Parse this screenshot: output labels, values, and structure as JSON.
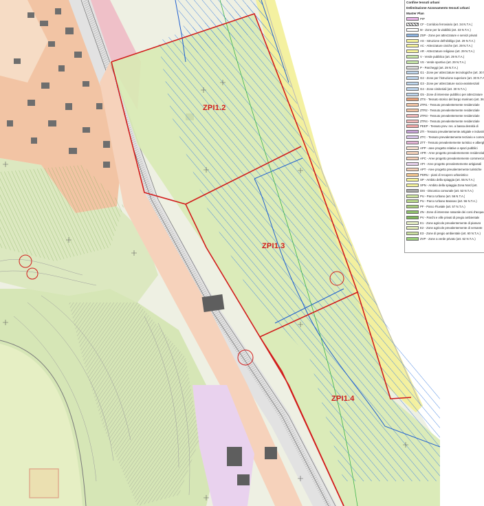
{
  "legend": {
    "top_lines": [
      "Confine tessuti urbani",
      "Delimitazione Azzonamento tessuti urbani"
    ],
    "header": "Master Plan",
    "items": [
      {
        "label": "PIP",
        "color": "#e9b6e8",
        "pattern": "solid"
      },
      {
        "label": "CF - Corridoio ferroviario (art. 34 N.T.A.)",
        "color": "#bfbfbf",
        "pattern": "hatch"
      },
      {
        "label": "M - Zone per la viabilità (art. 33 N.T.A.)",
        "color": "#ffffff",
        "pattern": "solid"
      },
      {
        "label": "ZSP - Zone per attrezzature e servizi privati",
        "color": "#8db4e2",
        "pattern": "solid"
      },
      {
        "label": "AS - Istruzione dell'obbligo (art. 29 N.T.A.)",
        "color": "#f6f39a",
        "pattern": "solid"
      },
      {
        "label": "AC - Attrezzature civiche (art. 29 N.T.A.)",
        "color": "#f6f39a",
        "pattern": "solid"
      },
      {
        "label": "AR - Attrezzature religiose (art. 29 N.T.A.)",
        "color": "#f6f39a",
        "pattern": "solid"
      },
      {
        "label": "V - Verde pubblico (art. 29 N.T.A.)",
        "color": "#c6e6a8",
        "pattern": "solid"
      },
      {
        "label": "VS - Verde sportivo (art. 29 N.T.A.)",
        "color": "#c6e6a8",
        "pattern": "solid"
      },
      {
        "label": "P - Parcheggi (art. 29 N.T.A.)",
        "color": "#d9d9d9",
        "pattern": "solid"
      },
      {
        "label": "G1 - Zone per attrezzature tecnologiche (art. 30 N.T.A.)",
        "color": "#bfd7ee",
        "pattern": "solid"
      },
      {
        "label": "G2 - Zone per l'istruzione superiore (art. 30 N.T.A.)",
        "color": "#bfd7ee",
        "pattern": "solid"
      },
      {
        "label": "G3 - Zone per attrezzature socio-assistenziali",
        "color": "#bfd7ee",
        "pattern": "solid"
      },
      {
        "label": "G4 - Zone cimiteriali (art. 30 N.T.A.)",
        "color": "#bfd7ee",
        "pattern": "solid"
      },
      {
        "label": "G5 - Zone di interesse pubblico per attrezzature",
        "color": "#bfd7ee",
        "pattern": "solid"
      },
      {
        "label": "ZTS - Tessuto storico del borgo marinaro (art. 36 N.T.A.)",
        "color": "#e8a27a",
        "pattern": "solid"
      },
      {
        "label": "ZTR1 - Tessuto prevalentemente residenziale",
        "color": "#f2c4a4",
        "pattern": "solid"
      },
      {
        "label": "ZTR2 - Tessuto prevalentemente residenziale",
        "color": "#f2c4a4",
        "pattern": "solid"
      },
      {
        "label": "ZTR3 - Tessuto prevalentemente residenziale",
        "color": "#f0b8b8",
        "pattern": "solid"
      },
      {
        "label": "ZTR4 - Tessuto prevalentemente residenziale",
        "color": "#f0b8b8",
        "pattern": "solid"
      },
      {
        "label": "PEEP - Tessuto prev. res. a bassa densità di",
        "color": "#f1a6a6",
        "pattern": "solid"
      },
      {
        "label": "ZTI - Tessuto prevalentemente artigiale e industriale",
        "color": "#c9a3d9",
        "pattern": "solid"
      },
      {
        "label": "ZTC - Tessuto prevalentemente terziario e commerciale",
        "color": "#d9c6ea",
        "pattern": "solid"
      },
      {
        "label": "ZTT - Tessuto prevalentemente turistico e alberghiero",
        "color": "#e5b3d6",
        "pattern": "solid"
      },
      {
        "label": "APP - aree progetto relative a spazi pubblici",
        "color": "#f6e1d1",
        "pattern": "solid"
      },
      {
        "label": "APR - Aree progetto prevalentemente residenziali",
        "color": "#f6d2bb",
        "pattern": "solid"
      },
      {
        "label": "APC - Aree progetto prevalentemente commerciali",
        "color": "#f6d2bb",
        "pattern": "solid"
      },
      {
        "label": "API - Aree progetto prevalentemente artigianali",
        "color": "#e9d2ee",
        "pattern": "solid"
      },
      {
        "label": "APT - Aree progetto prevalentemente turistiche",
        "color": "#f6d2bb",
        "pattern": "solid"
      },
      {
        "label": "PDRU - piani di recupero urbanistico",
        "color": "#f5c58e",
        "pattern": "solid"
      },
      {
        "label": "SP - Ambito della spiaggia (art. 55 N.T.A.)",
        "color": "#f6f39a",
        "pattern": "solid"
      },
      {
        "label": "SPN - Ambito della spiaggia Zona Nord (art.",
        "color": "#f6f39a",
        "pattern": "solid"
      },
      {
        "label": "DIS - Discarica comunale (art. 53 N.T.A.)",
        "color": "#a8a8a8",
        "pattern": "solid"
      },
      {
        "label": "PU - Parco Urbano (art. 56 N.T.A.)",
        "color": "#cfe6a1",
        "pattern": "solid"
      },
      {
        "label": "PU - Parco Urbano Baraseo (art. 56 N.T.A.)",
        "color": "#b9d88a",
        "pattern": "solid"
      },
      {
        "label": "PF - Parco Fluviale (art. 57 N.T.A.)",
        "color": "#a9cf7e",
        "pattern": "solid"
      },
      {
        "label": "ZN - Zone di interesse naturale dei corsi d'acqua",
        "color": "#8fc06c",
        "pattern": "solid"
      },
      {
        "label": "PV - Parchi e ville privati di pregio ambientale",
        "color": "#7fb85c",
        "pattern": "solid"
      },
      {
        "label": "E1 - Zone agricole prevalentemente di pianura",
        "color": "#e6efc4",
        "pattern": "solid"
      },
      {
        "label": "E2 - Zone agricole prevalentemente di versante",
        "color": "#dfe9b5",
        "pattern": "solid"
      },
      {
        "label": "E3 - Zone di pregio ambientale (art. 60 N.T.A.)",
        "color": "#cbe0a0",
        "pattern": "solid"
      },
      {
        "label": "ZVP - Zone a verde privato (art. 62 N.T.A.)",
        "color": "#9bd17a",
        "pattern": "solid"
      }
    ]
  },
  "map_labels": {
    "zpi_north": "ZPI1.2",
    "zpi_central": "ZPI1.3",
    "zpi_south": "ZPI1.4"
  },
  "map_colors": {
    "zpi_boundary": "#d21a1a",
    "zsp_hatch": "#2a6fd6",
    "zsp_outline": "#1f5fd0",
    "residential": "#f2c4a4",
    "urban_park": "#d8eab4",
    "beach": "#f6f39a",
    "sea": "#ffffff",
    "railway": "#c8c8c8"
  }
}
